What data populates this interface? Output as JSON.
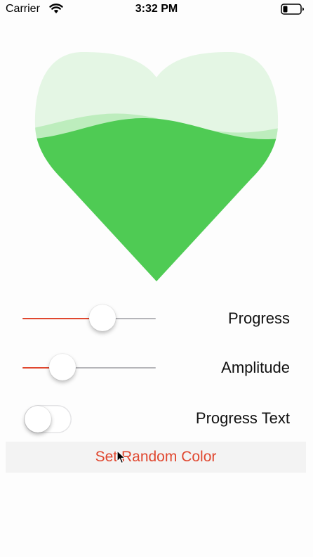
{
  "status_bar": {
    "carrier": "Carrier",
    "time": "3:32 PM",
    "wifi_icon": "wifi-icon",
    "battery_icon": "battery-icon"
  },
  "heart": {
    "fill_color": "#4fcb54",
    "back_wave_color": "#bdedbd",
    "empty_color": "#e4f6e4",
    "progress": 0.7
  },
  "controls": {
    "progress": {
      "label": "Progress",
      "value": 0.6
    },
    "amplitude": {
      "label": "Amplitude",
      "value": 0.3
    },
    "progress_text": {
      "label": "Progress Text",
      "on": false
    }
  },
  "button": {
    "label": "Set Random Color"
  },
  "colors": {
    "accent": "#e0472f",
    "track": "#b5b5b9"
  }
}
